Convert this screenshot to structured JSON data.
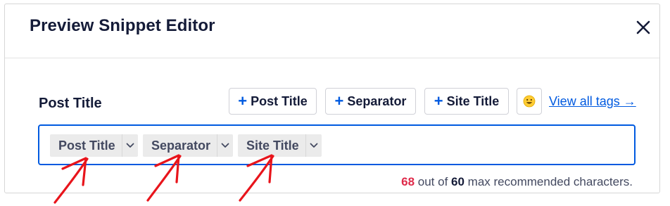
{
  "modal": {
    "title": "Preview Snippet Editor"
  },
  "field": {
    "label": "Post Title"
  },
  "tag_buttons": [
    {
      "plus": "+",
      "label": "Post Title"
    },
    {
      "plus": "+",
      "label": "Separator"
    },
    {
      "plus": "+",
      "label": "Site Title"
    }
  ],
  "emoji_icon": "smiley-emoji-icon",
  "view_all_link": "View all tags →",
  "chips": [
    {
      "label": "Post Title"
    },
    {
      "label": "Separator"
    },
    {
      "label": "Site Title"
    }
  ],
  "counter": {
    "current": "68",
    "text1": " out of ",
    "max": "60",
    "text2": " max recommended characters."
  },
  "colors": {
    "accent": "#005ae0",
    "warning": "#df2a4a",
    "annotation": "#e8141b"
  }
}
